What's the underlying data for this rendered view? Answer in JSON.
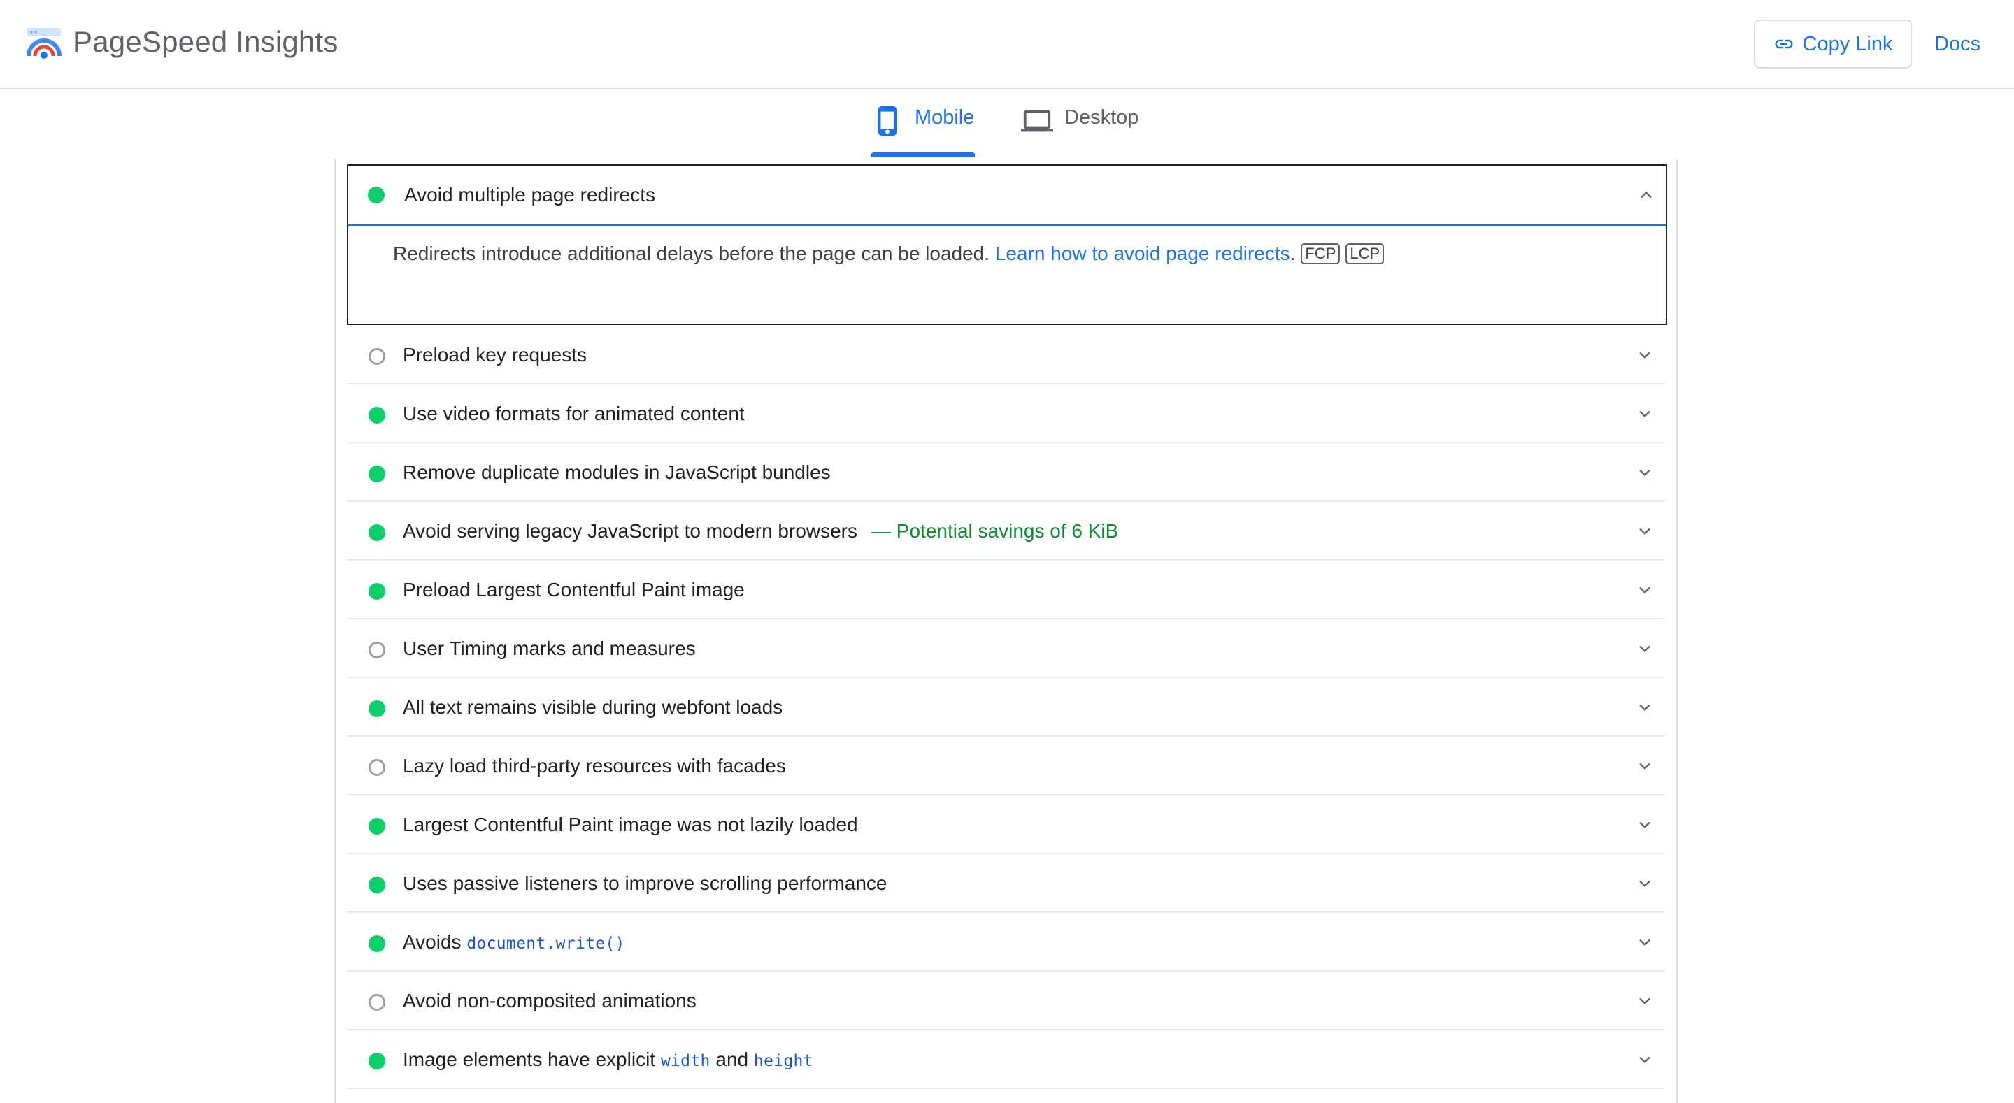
{
  "header": {
    "app_title": "PageSpeed Insights",
    "copy_link_label": "Copy Link",
    "docs_label": "Docs",
    "logo_icon": "pagespeed-gauge-logo",
    "copy_link_icon": "link-icon"
  },
  "tabs": [
    {
      "label": "Mobile",
      "icon": "smartphone-icon",
      "active": true
    },
    {
      "label": "Desktop",
      "icon": "laptop-icon",
      "active": false
    }
  ],
  "expanded_audit": {
    "title": "Avoid multiple page redirects",
    "status": "pass",
    "description": "Redirects introduce additional delays before the page can be loaded. ",
    "link_text": "Learn how to avoid page redirects",
    "after_link": ".",
    "tags": [
      "FCP",
      "LCP"
    ]
  },
  "audits": [
    {
      "status": "info",
      "title": "Preload key requests"
    },
    {
      "status": "pass",
      "title": "Use video formats for animated content"
    },
    {
      "status": "pass",
      "title": "Remove duplicate modules in JavaScript bundles"
    },
    {
      "status": "pass",
      "title": "Avoid serving legacy JavaScript to modern browsers",
      "savings": "— Potential savings of 6 KiB"
    },
    {
      "status": "pass",
      "title": "Preload Largest Contentful Paint image"
    },
    {
      "status": "info",
      "title": "User Timing marks and measures"
    },
    {
      "status": "pass",
      "title": "All text remains visible during webfont loads"
    },
    {
      "status": "info",
      "title": "Lazy load third-party resources with facades"
    },
    {
      "status": "pass",
      "title": "Largest Contentful Paint image was not lazily loaded"
    },
    {
      "status": "pass",
      "title": "Uses passive listeners to improve scrolling performance"
    },
    {
      "status": "pass",
      "title": "Avoids ",
      "code": "document.write()"
    },
    {
      "status": "info",
      "title": "Avoid non-composited animations"
    },
    {
      "status": "pass",
      "title": "Image elements have explicit ",
      "code": "width",
      "mid": " and ",
      "code2": "height"
    }
  ],
  "colors": {
    "accent": "#1a73e8",
    "pass": "#0cce6b",
    "savings": "#0d8a2e",
    "info": "#9e9e9e"
  }
}
